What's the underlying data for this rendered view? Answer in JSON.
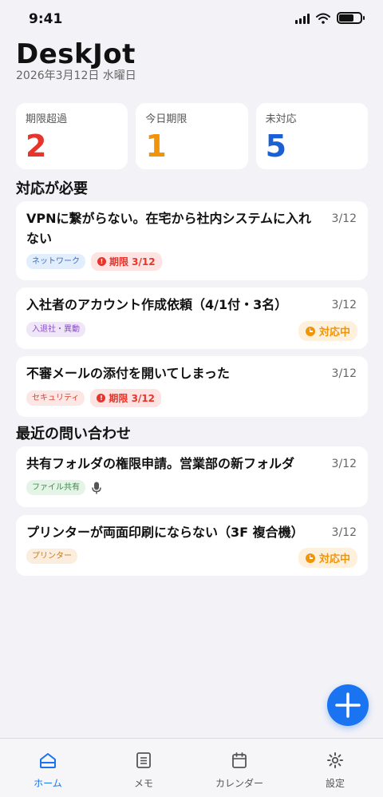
{
  "status_bar": {
    "time": "9:41"
  },
  "header": {
    "title": "DeskJot",
    "date": "2026年3月12日 水曜日"
  },
  "stats": [
    {
      "label": "期限超過",
      "value": "2",
      "color": "#e6352b"
    },
    {
      "label": "今日期限",
      "value": "1",
      "color": "#f0940a"
    },
    {
      "label": "未対応",
      "value": "5",
      "color": "#1a5fd6"
    }
  ],
  "sections": {
    "needs_action": "対応が必要",
    "recent": "最近の問い合わせ"
  },
  "needs_action": [
    {
      "title": "VPNに繋がらない。在宅から社内システムに入れない",
      "date": "3/12",
      "category": "ネットワーク",
      "due": "期限 3/12"
    },
    {
      "title": "入社者のアカウント作成依頼（4/1付・3名）",
      "date": "3/12",
      "category": "入退社・異動",
      "status": "対応中"
    },
    {
      "title": "不審メールの添付を開いてしまった",
      "date": "3/12",
      "category": "セキュリティ",
      "due": "期限 3/12"
    }
  ],
  "recent": [
    {
      "title": "共有フォルダの権限申請。営業部の新フォルダ",
      "date": "3/12",
      "category": "ファイル共有",
      "icon": "mic-icon"
    },
    {
      "title": "プリンターが両面印刷にならない（3F 複合機）",
      "date": "3/12",
      "category": "プリンター",
      "status": "対応中"
    }
  ],
  "category_colors": {
    "network": {
      "bg": "#e3eefc",
      "fg": "#2f6fd0"
    },
    "hr": {
      "bg": "#efe6f8",
      "fg": "#8a4fc4"
    },
    "security": {
      "bg": "#fde7e5",
      "fg": "#d4463a"
    },
    "file": {
      "bg": "#e4f4e6",
      "fg": "#3a8d48"
    },
    "printer": {
      "bg": "#fbeede",
      "fg": "#c07a2a"
    }
  },
  "tabs": [
    {
      "label": "ホーム",
      "icon": "home-icon",
      "active": true
    },
    {
      "label": "メモ",
      "icon": "memo-icon",
      "active": false
    },
    {
      "label": "カレンダー",
      "icon": "calendar-icon",
      "active": false
    },
    {
      "label": "設定",
      "icon": "gear-icon",
      "active": false
    }
  ],
  "accent_color": "#1a73f0"
}
